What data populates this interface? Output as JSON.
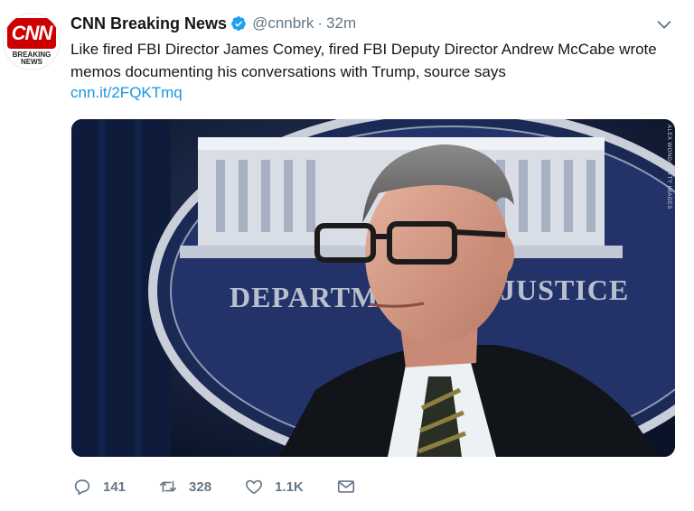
{
  "tweet": {
    "avatar": {
      "brand": "CNN",
      "caption_line1": "BREAKING",
      "caption_line2": "NEWS"
    },
    "author_name": "CNN Breaking News",
    "handle": "@cnnbrk",
    "separator": "·",
    "time": "32m",
    "text": "Like fired FBI Director James Comey, fired FBI Deputy Director Andrew McCabe wrote memos documenting his conversations with Trump, source says",
    "link": "cnn.it/2FQKTmq",
    "media": {
      "seal_text_left": "DEPARTM",
      "seal_text_right": "JUSTICE",
      "credit": "ALEX WONG/GETTY IMAGES"
    },
    "actions": {
      "replies": "141",
      "retweets": "328",
      "likes": "1.1K"
    }
  },
  "colors": {
    "link": "#1b95e0",
    "muted": "#657786",
    "verified": "#1da1f2",
    "brand_red": "#cc0000"
  }
}
